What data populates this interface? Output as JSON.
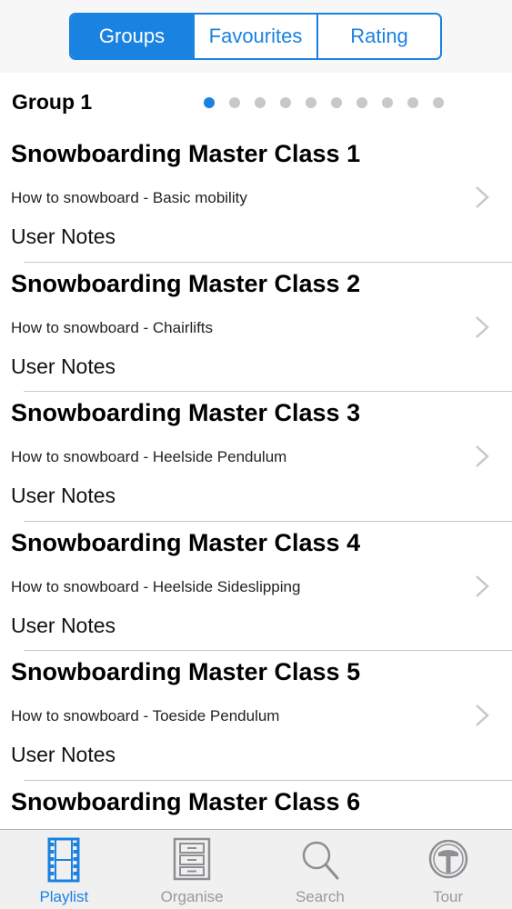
{
  "segments": [
    {
      "label": "Groups",
      "active": true
    },
    {
      "label": "Favourites",
      "active": false
    },
    {
      "label": "Rating",
      "active": false
    }
  ],
  "group": {
    "title": "Group 1",
    "page_count": 10,
    "current_page": 1
  },
  "rows": [
    {
      "title": "Snowboarding Master Class 1",
      "subtitle": "How to snowboard - Basic mobility",
      "notes": "User Notes"
    },
    {
      "title": "Snowboarding Master Class 2",
      "subtitle": "How to snowboard - Chairlifts",
      "notes": "User Notes"
    },
    {
      "title": "Snowboarding Master Class 3",
      "subtitle": "How to snowboard - Heelside Pendulum",
      "notes": "User Notes"
    },
    {
      "title": "Snowboarding Master Class 4",
      "subtitle": "How to snowboard - Heelside Sideslipping",
      "notes": "User Notes"
    },
    {
      "title": "Snowboarding Master Class 5",
      "subtitle": "How to snowboard - Toeside Pendulum",
      "notes": "User Notes"
    },
    {
      "title": "Snowboarding Master Class 6",
      "subtitle": "",
      "notes": ""
    }
  ],
  "tabs": [
    {
      "label": "Playlist",
      "icon": "film-strip-icon",
      "active": true
    },
    {
      "label": "Organise",
      "icon": "cabinet-icon",
      "active": false
    },
    {
      "label": "Search",
      "icon": "search-icon",
      "active": false
    },
    {
      "label": "Tour",
      "icon": "tour-icon",
      "active": false
    }
  ],
  "colors": {
    "accent": "#1a82e0",
    "inactive_tab": "#999999",
    "separator": "#c8c7cc"
  }
}
